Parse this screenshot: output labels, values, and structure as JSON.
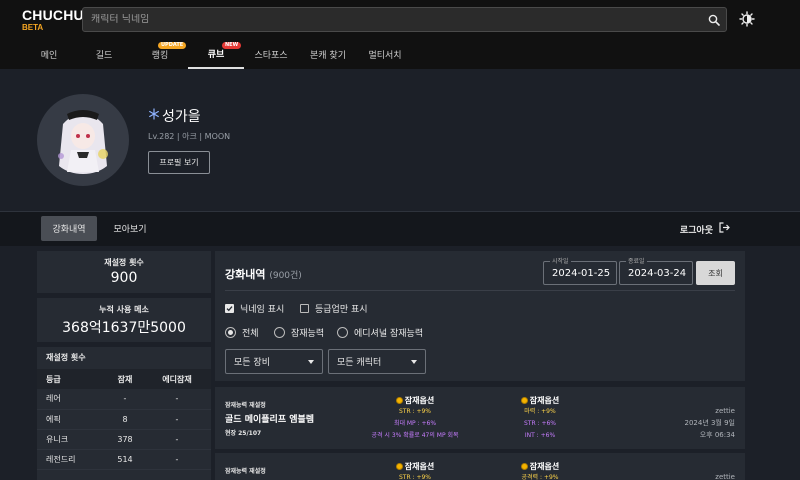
{
  "header": {
    "logo": "CHUCHU",
    "logo_badge": "BETA",
    "search_placeholder": "캐릭터 닉네임",
    "nav": [
      {
        "label": "메인"
      },
      {
        "label": "길드"
      },
      {
        "label": "랭킹",
        "badge": "UPDATE"
      },
      {
        "label": "큐브",
        "badge": "NEW",
        "active": true
      },
      {
        "label": "스타포스"
      },
      {
        "label": "본캐 찾기"
      },
      {
        "label": "멀티서치"
      }
    ]
  },
  "profile": {
    "name": "성가을",
    "info": "Lv.282 | 아크 | MOON",
    "button": "프로필 보기"
  },
  "tabs": {
    "active": "강화내역",
    "second": "모아보기",
    "logout": "로그아웃"
  },
  "stats": {
    "reset_count_title": "재설정 횟수",
    "reset_count_value": "900",
    "mesos_title": "누적 사용 메소",
    "mesos_value": "368억1637만5000"
  },
  "reset_table": {
    "title": "재설정 횟수",
    "headers": [
      "등급",
      "잠재",
      "에디잠재"
    ],
    "rows": [
      [
        "레어",
        "-",
        "-"
      ],
      [
        "에픽",
        "8",
        "-"
      ],
      [
        "유니크",
        "378",
        "-"
      ],
      [
        "레전드리",
        "514",
        "-"
      ]
    ]
  },
  "panel": {
    "title": "강화내역",
    "count": "(900건)",
    "start_label": "시작일",
    "start_value": "2024-01-25",
    "end_label": "종료일",
    "end_value": "2024-03-24",
    "query": "조회",
    "check_nickname": "닉네임 표시",
    "check_grade_up": "등급업만 표시",
    "radio_all": "전체",
    "radio_potential": "잠재능력",
    "radio_additional": "에디셔널 잠재능력",
    "select_equipment": "모든 장비",
    "select_character": "모든 캐릭터"
  },
  "records": [
    {
      "type": "잠재능력 재설정",
      "item": "골드 메이플리프 엠블렘",
      "stars": "현장 25/107",
      "opt_title": "잠재옵션",
      "before": [
        "STR : +9%",
        "최대 MP : +6%",
        "공격 시 3% 확률로 47의 MP 회복"
      ],
      "after": [
        "마력 : +9%",
        "STR : +6%",
        "INT : +6%"
      ],
      "user": "zettie",
      "date": "2024년 3월 9일",
      "time": "오후 06:34"
    },
    {
      "type": "잠재능력 재설정",
      "opt_title": "잠재옵션",
      "before": [
        "STR : +9%"
      ],
      "after": [
        "공격력 : +9%"
      ],
      "user": "zettie"
    }
  ],
  "colors": {
    "accent_yellow": "#ffd54a",
    "accent_purple": "#c77dff",
    "badge_update": "#f5a623",
    "badge_new": "#e53935"
  }
}
